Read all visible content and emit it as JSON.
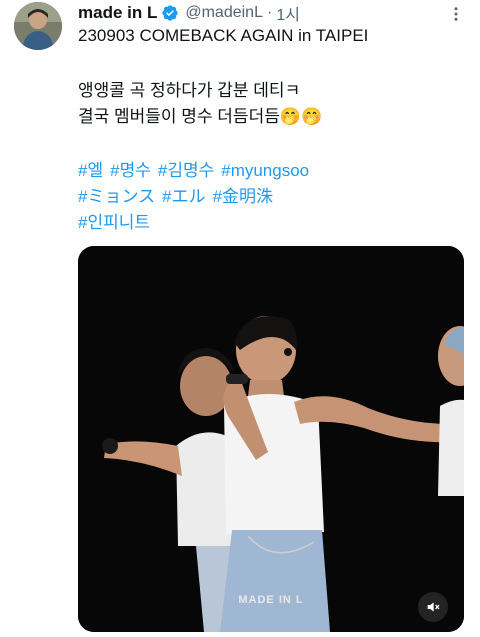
{
  "tweet": {
    "author_name": "made in L",
    "handle": "@madeinL",
    "separator": "·",
    "time": "1시",
    "title_line": "230903 COMEBACK AGAIN in TAIPEI",
    "body_lines": [
      "앵앵콜 곡 정하다가 갑분 데티ㅋ",
      "결국 멤버들이 명수 더듬더듬🤭🤭"
    ],
    "hashtags": {
      "row1": [
        "#엘",
        "#명수",
        "#김명수",
        "#myungsoo"
      ],
      "row2": [
        "#ミョンス",
        "#エル",
        "#金明洙"
      ],
      "row3": [
        "#인피니트"
      ]
    }
  },
  "media": {
    "watermark": "MADE IN L",
    "type": "video"
  },
  "icons": {
    "verified": "verified-badge-icon",
    "more": "more-options-icon",
    "mute": "mute-icon"
  },
  "colors": {
    "link": "#1d9bf0",
    "verified": "#1d9bf0",
    "secondary_text": "#536471"
  }
}
